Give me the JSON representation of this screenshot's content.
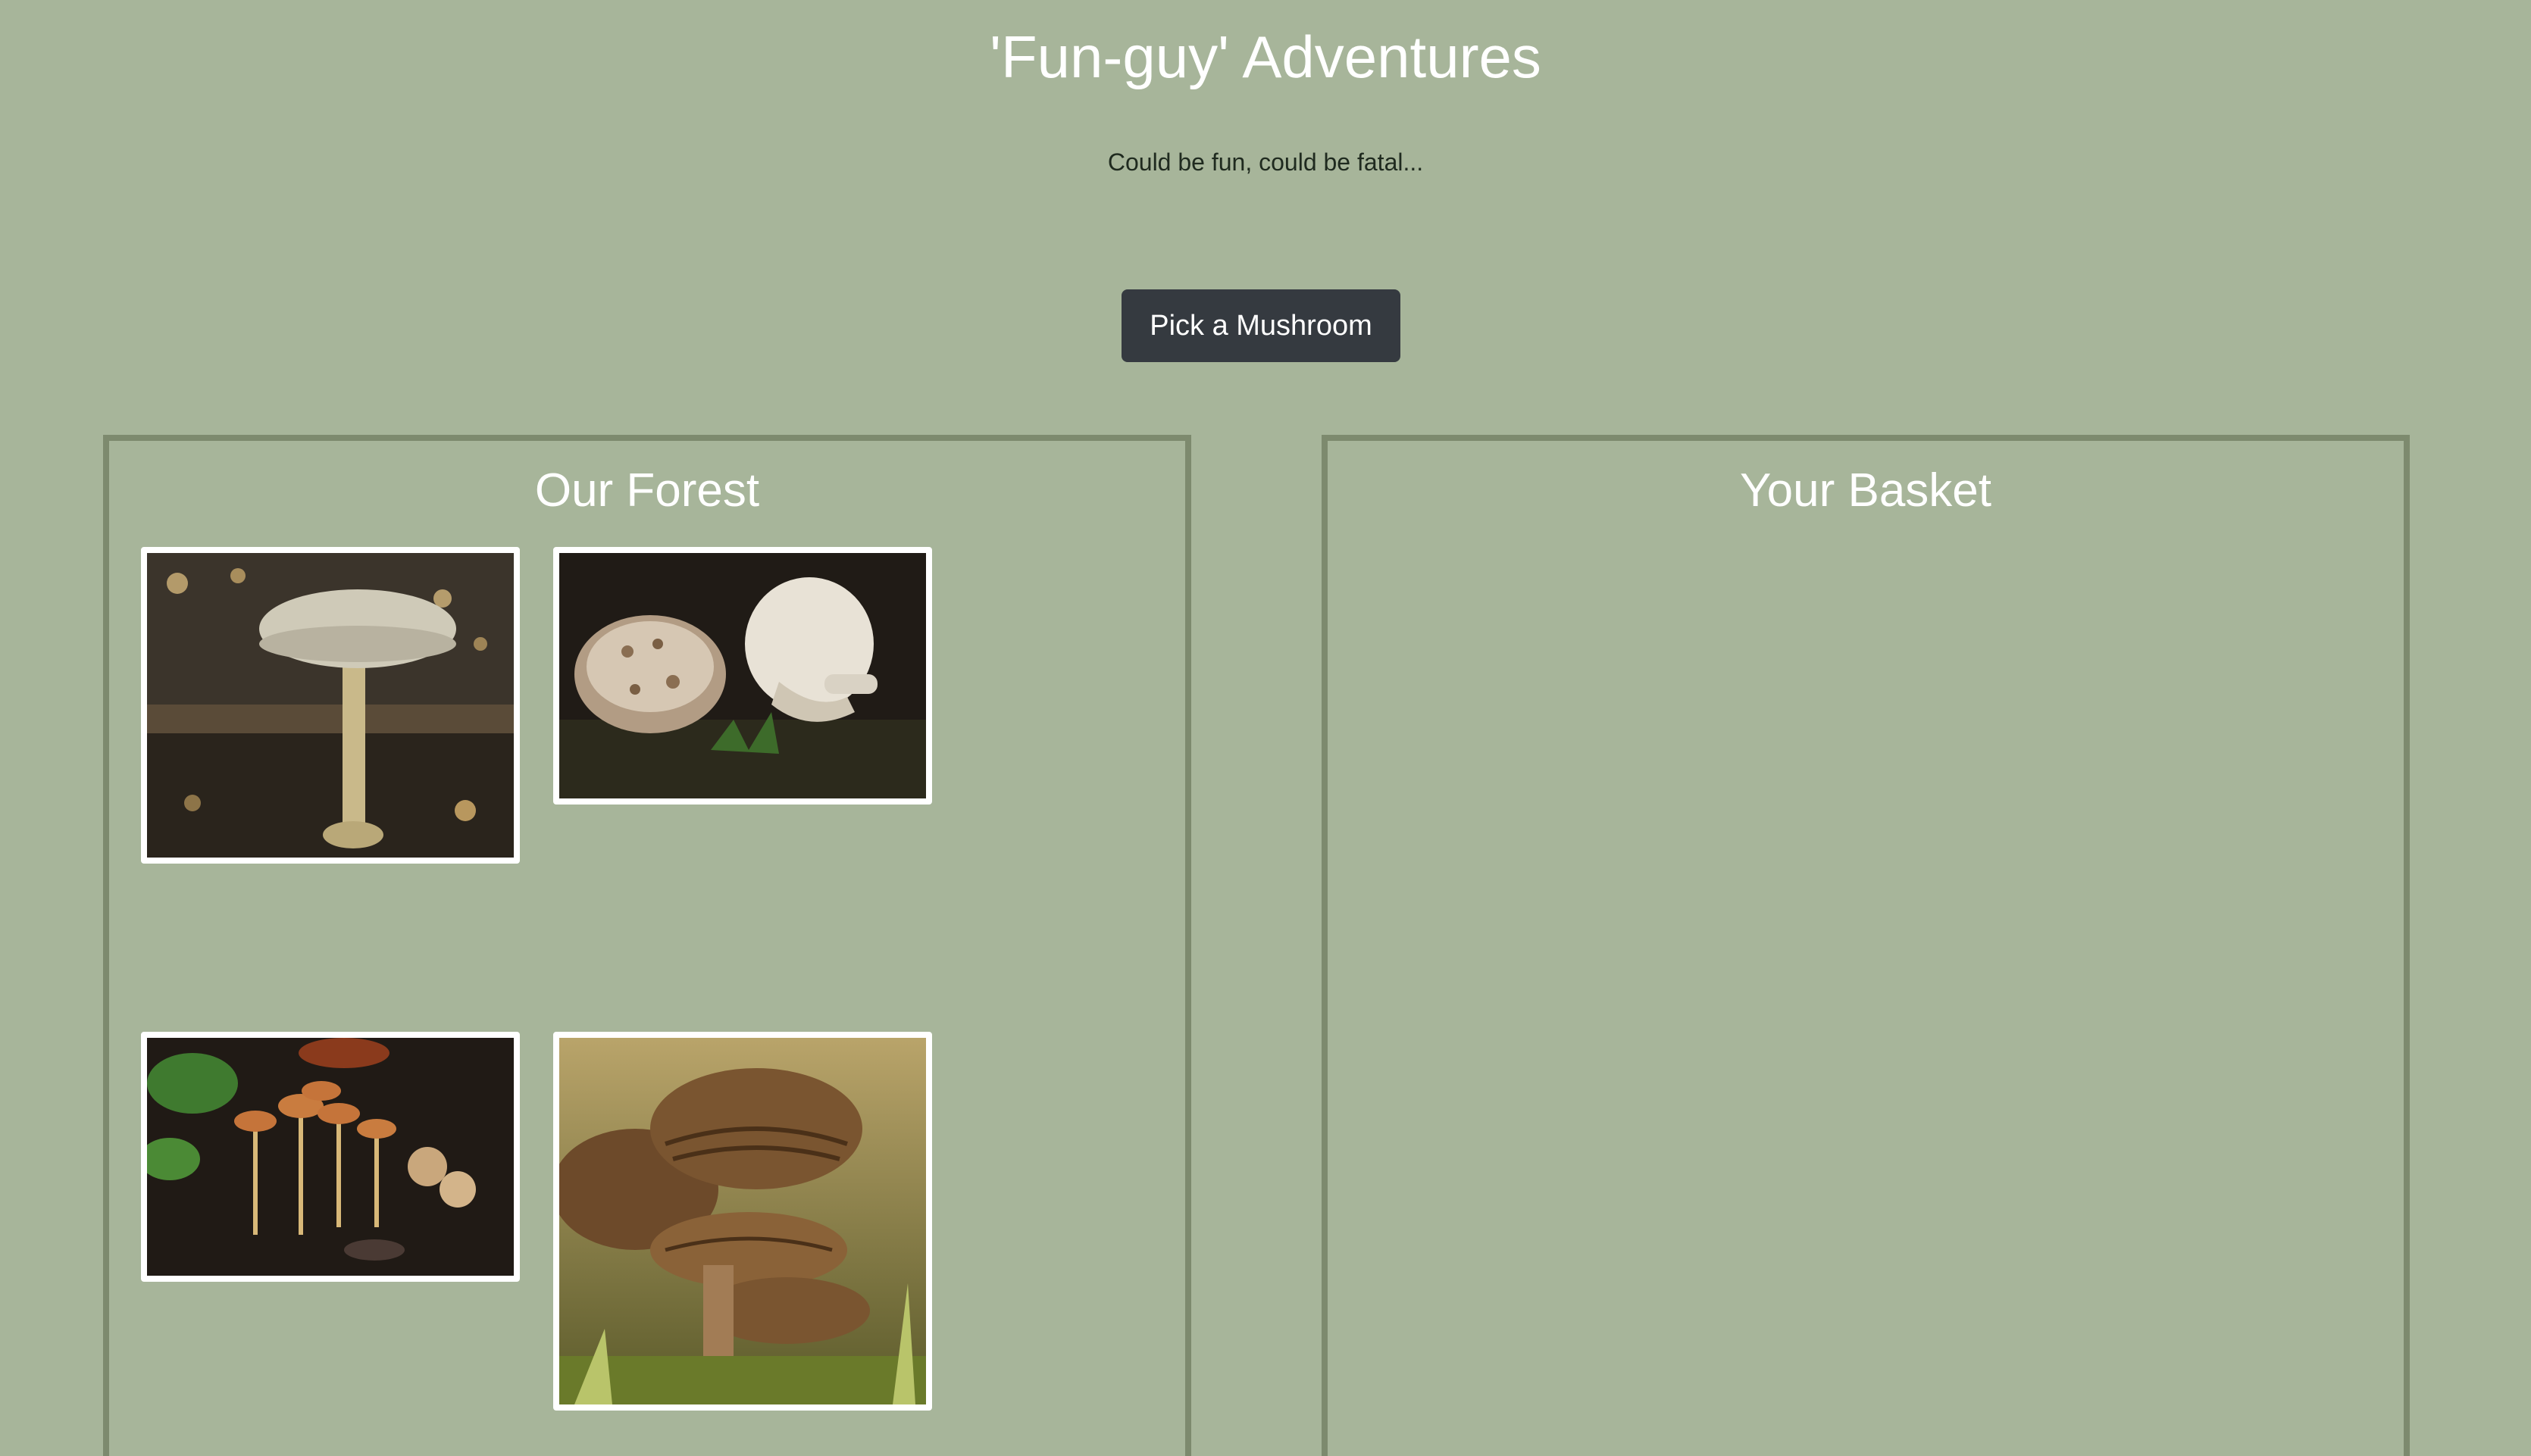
{
  "header": {
    "title": "'Fun-guy' Adventures",
    "tagline": "Could be fun, could be fatal..."
  },
  "actions": {
    "pick_label": "Pick a Mushroom"
  },
  "forest": {
    "heading": "Our Forest",
    "mushrooms": [
      {
        "id": "mushroom-1",
        "icon": "death-cap-photo",
        "cap_color": "#cfcab8",
        "stem_color": "#c9b98a"
      },
      {
        "id": "mushroom-2",
        "icon": "pale-mushrooms-photo",
        "cap_color": "#e8e2d6",
        "stem_color": "#d9d2c4"
      },
      {
        "id": "mushroom-3",
        "icon": "orange-cluster-photo",
        "cap_color": "#c5743a",
        "stem_color": "#d8b878"
      },
      {
        "id": "mushroom-4",
        "icon": "brown-gilled-photo",
        "cap_color": "#7a5530",
        "stem_color": "#a27c55"
      }
    ]
  },
  "basket": {
    "heading": "Your Basket",
    "items": []
  },
  "colors": {
    "background": "#a7b59a",
    "panel_border": "#7d8a6e",
    "button": "#353a40"
  }
}
